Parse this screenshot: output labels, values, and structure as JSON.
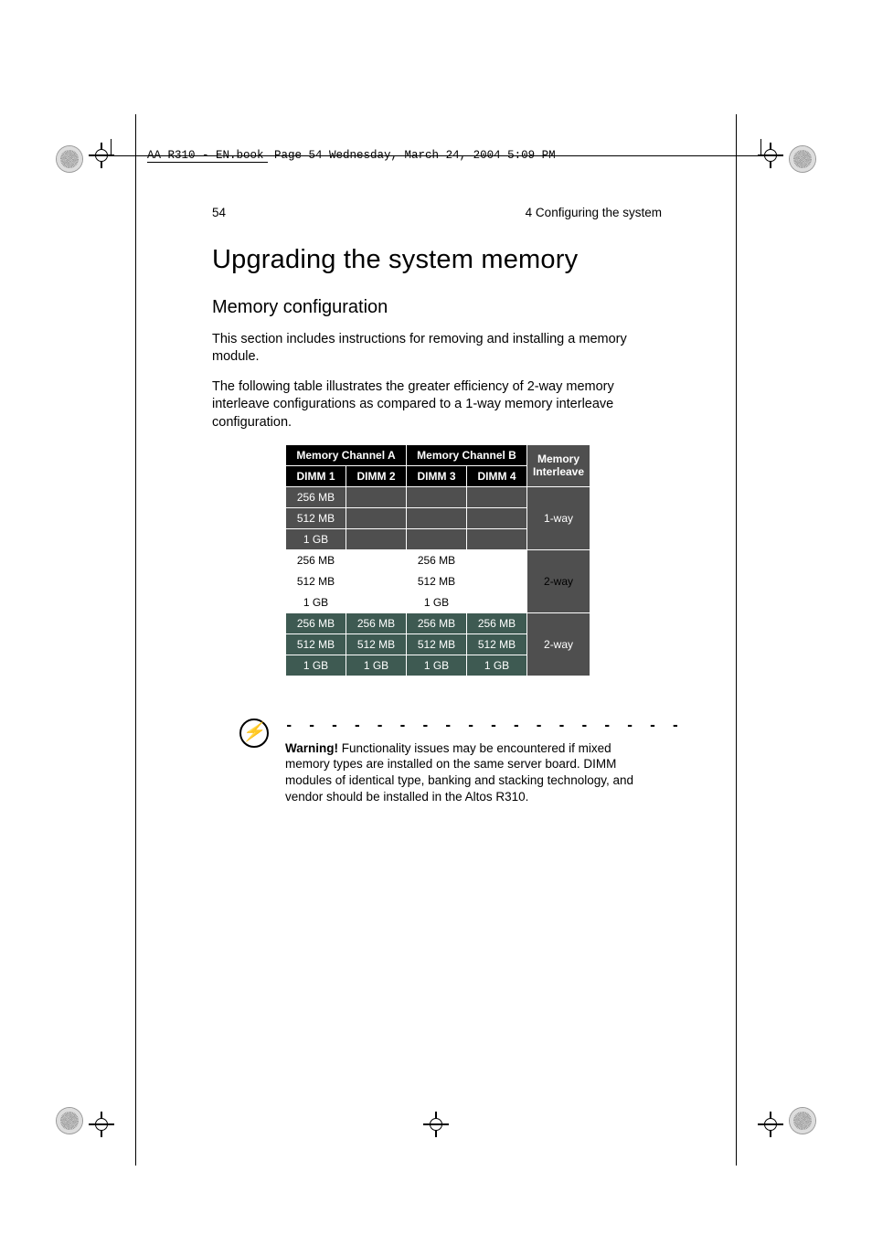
{
  "meta": {
    "book_line_prefix": "AA R310 - EN.book",
    "book_line_rest": "  Page 54  Wednesday, March 24, 2004  5:09 PM"
  },
  "header": {
    "page_number": "54",
    "chapter": "4 Configuring the system"
  },
  "h1": "Upgrading the system memory",
  "h2": "Memory configuration",
  "p1": "This section includes instructions for removing and installing a memory module.",
  "p2": "The following table illustrates the greater efficiency of 2-way memory interleave configurations as compared to a 1-way memory interleave configuration.",
  "table": {
    "channel_a": "Memory Channel A",
    "channel_b": "Memory Channel B",
    "mem_col": "Memory",
    "interleave": "Interleave",
    "dimm1": "DIMM 1",
    "dimm2": "DIMM 2",
    "dimm3": "DIMM 3",
    "dimm4": "DIMM 4"
  },
  "chart_data": {
    "type": "table",
    "columns": [
      "DIMM 1",
      "DIMM 2",
      "DIMM 3",
      "DIMM 4",
      "Memory Interleave"
    ],
    "groups": [
      {
        "interleave": "1-way",
        "rows": [
          [
            "256 MB",
            "",
            "",
            ""
          ],
          [
            "512 MB",
            "",
            "",
            ""
          ],
          [
            "1 GB",
            "",
            "",
            ""
          ]
        ]
      },
      {
        "interleave": "2-way",
        "rows": [
          [
            "256 MB",
            "",
            "256 MB",
            ""
          ],
          [
            "512 MB",
            "",
            "512 MB",
            ""
          ],
          [
            "1 GB",
            "",
            "1 GB",
            ""
          ]
        ]
      },
      {
        "interleave": "2-way",
        "rows": [
          [
            "256 MB",
            "256 MB",
            "256 MB",
            "256 MB"
          ],
          [
            "512 MB",
            "512 MB",
            "512 MB",
            "512 MB"
          ],
          [
            "1 GB",
            "1 GB",
            "1 GB",
            "1 GB"
          ]
        ]
      }
    ]
  },
  "warning": {
    "label": "Warning!",
    "text": " Functionality issues may be encountered if mixed memory types are installed on the same server board. DIMM modules of identical type, banking and stacking technology, and vendor should be installed in the Altos R310."
  },
  "dashes": "- - - - - - - - - - - - - - - - - - - - - - - - - - - - - - - - - - - - - - - - - - - -"
}
